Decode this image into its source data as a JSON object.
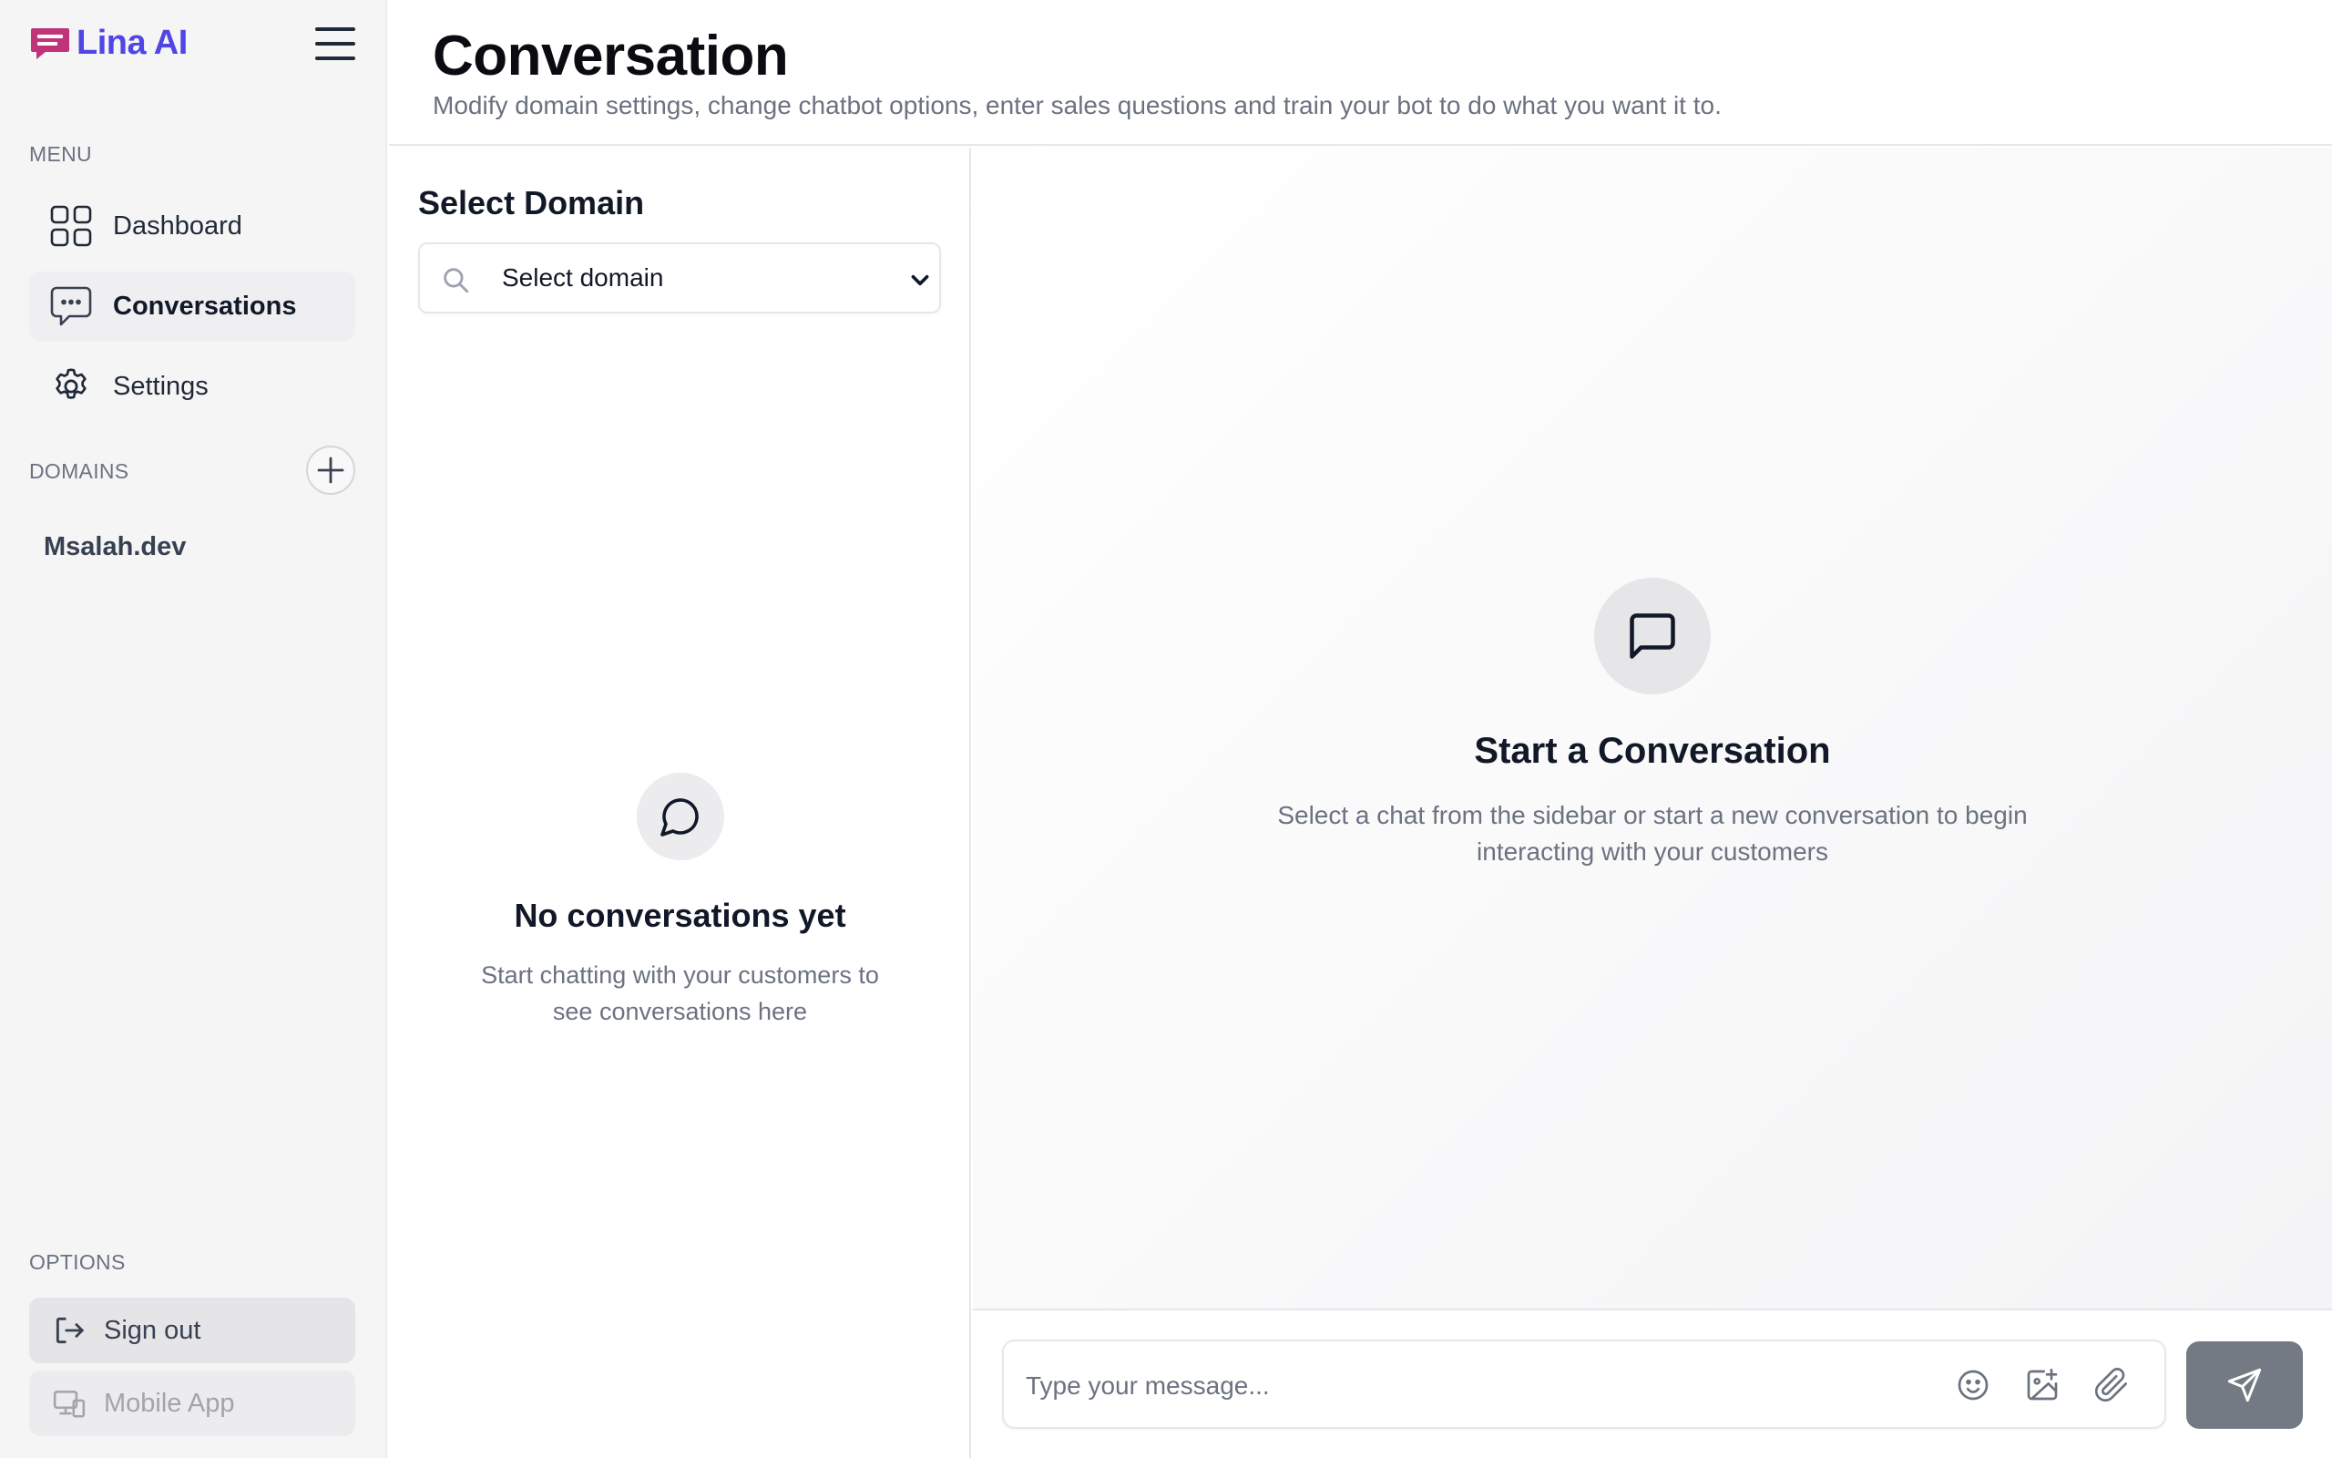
{
  "app": {
    "name": "Lina AI"
  },
  "colors": {
    "brand_blue": "#4f46e5",
    "brand_pink": "#c0357a",
    "send_button": "#737a84"
  },
  "sidebar": {
    "menu_label": "MENU",
    "items": [
      {
        "label": "Dashboard",
        "icon": "dashboard-grid-icon"
      },
      {
        "label": "Conversations",
        "icon": "chat-bubble-dots-icon",
        "active": true
      },
      {
        "label": "Settings",
        "icon": "gear-icon"
      }
    ],
    "domains_label": "DOMAINS",
    "domains": [
      {
        "label": "Msalah.dev"
      }
    ],
    "options_label": "OPTIONS",
    "options": [
      {
        "label": "Sign out",
        "icon": "sign-out-icon"
      },
      {
        "label": "Mobile App",
        "icon": "devices-icon"
      }
    ]
  },
  "header": {
    "title": "Conversation",
    "subtitle": "Modify domain settings, change chatbot options, enter sales questions and train your bot to do what you want it to."
  },
  "domain_panel": {
    "heading": "Select Domain",
    "select_value": "Select domain",
    "empty_title": "No conversations yet",
    "empty_text": "Start chatting with your customers to see conversations here"
  },
  "chat_panel": {
    "empty_title": "Start a Conversation",
    "empty_text": "Select a chat from the sidebar or start a new conversation to begin interacting with your customers"
  },
  "composer": {
    "placeholder": "Type your message...",
    "value": ""
  }
}
